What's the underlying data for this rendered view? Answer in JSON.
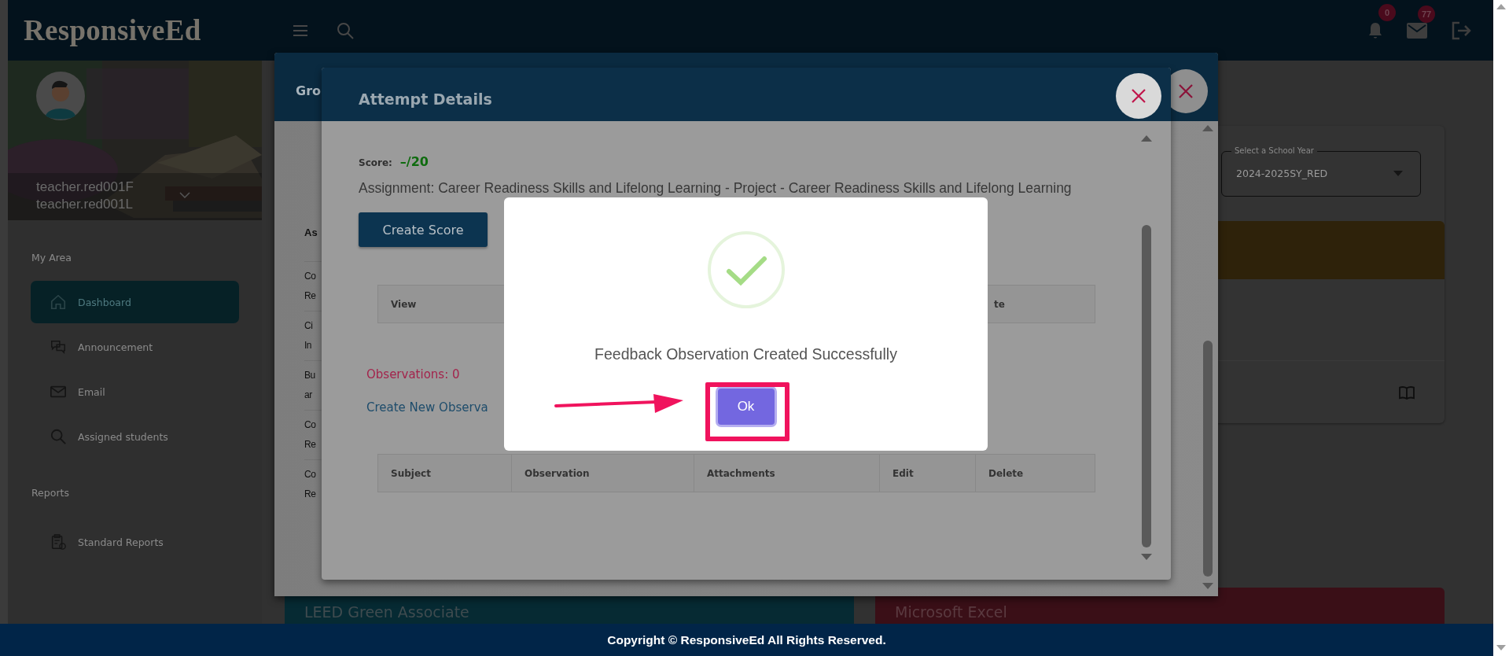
{
  "header": {
    "logo": "ResponsiveEd",
    "notifications": {
      "count": "0"
    },
    "messages": {
      "count": "77"
    }
  },
  "profile": {
    "first_name": "teacher.red001F",
    "last_name": "teacher.red001L"
  },
  "sidebar": {
    "sections": [
      {
        "title": "My Area",
        "items": [
          {
            "label": "Dashboard",
            "selected": true
          },
          {
            "label": "Announcement",
            "selected": false
          },
          {
            "label": "Email",
            "selected": false
          },
          {
            "label": "Assigned students",
            "selected": false
          }
        ]
      },
      {
        "title": "Reports",
        "items": [
          {
            "label": "Standard Reports",
            "selected": false
          }
        ]
      }
    ]
  },
  "school_year": {
    "label": "Select a School Year",
    "value": "2024-2025SY_RED"
  },
  "courses": [
    {
      "title": "LEED Green Associate",
      "color": "#062a33"
    },
    {
      "title": "Microsoft Excel",
      "color": "#3a0f17"
    }
  ],
  "group_modal": {
    "title": "Gro",
    "header_cell": "As",
    "rows": [
      {
        "line_1": "Co",
        "line_2": "Re"
      },
      {
        "line_1": "Ci",
        "line_2": "In"
      },
      {
        "line_1": "Bu",
        "line_2": "ar"
      },
      {
        "line_1": "Co",
        "line_2": "Re"
      },
      {
        "line_1": "Co",
        "line_2": "Re"
      }
    ]
  },
  "attempt_modal": {
    "title": "Attempt Details",
    "score_label": "Score:",
    "score": "–/20",
    "assignment": "Assignment: Career Readiness Skills and Lifelong Learning - Project - Career Readiness Skills and Lifelong Learning",
    "create_score": "Create Score",
    "attempts_table": {
      "columns": [
        "View",
        "te"
      ]
    },
    "observations": "Observations: 0",
    "create_observation": "Create New Observa",
    "observations_table": {
      "columns": [
        "Subject",
        "Observation",
        "Attachments",
        "Edit",
        "Delete"
      ]
    }
  },
  "alert": {
    "message": "Feedback Observation Created Successfully",
    "button": "Ok"
  },
  "footer": {
    "text": "Copyright © ResponsiveEd All Rights Reserved."
  }
}
